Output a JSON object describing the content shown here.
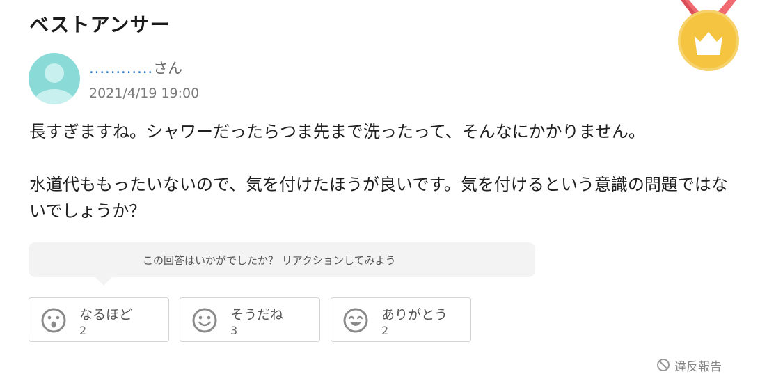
{
  "heading": "ベストアンサー",
  "answer": {
    "user_dots": "............",
    "user_suffix": "さん",
    "timestamp": "2021/4/19 19:00",
    "paragraph1": "長すぎますね。シャワーだったらつま先まで洗ったって、そんなにかかりません。",
    "paragraph2": "水道代ももったいないので、気を付けたほうが良いです。気を付けるという意識の問題ではないでしょうか？"
  },
  "reaction_prompt": "この回答はいかがでしたか？ リアクションしてみよう",
  "reactions": [
    {
      "label": "なるほど",
      "count": "2",
      "icon": "surprised-face-icon"
    },
    {
      "label": "そうだね",
      "count": "3",
      "icon": "smiling-face-icon"
    },
    {
      "label": "ありがとう",
      "count": "2",
      "icon": "grinning-face-icon"
    }
  ],
  "report_label": "違反報告",
  "colors": {
    "medal_gold": "#f5c542",
    "ribbon": "#f06a72",
    "avatar": "#8adad8",
    "user_link": "#1e73c8"
  }
}
